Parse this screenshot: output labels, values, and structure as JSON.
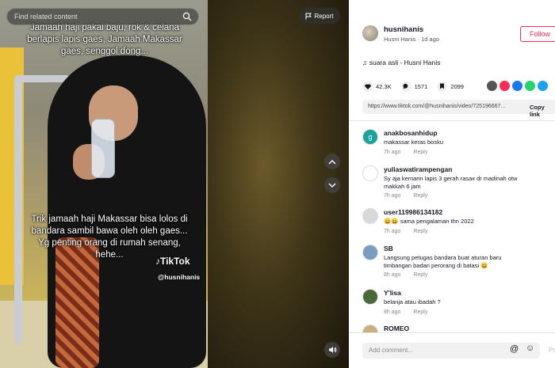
{
  "video": {
    "search_placeholder": "Find related content",
    "report_label": "Report",
    "caption_top": "Jamaah haji pakai baju, rok & celana berlapis lapis gaes, Jamaah Makassar gaes, senggol dong...",
    "caption_bottom": "Trik jamaah haji Makassar bisa lolos di bandara sambil bawa oleh oleh gaes... Yg penting orang di rumah senang, hehe...",
    "watermark": "TikTok",
    "watermark_handle": "@husnihanis"
  },
  "author": {
    "username": "husnihanis",
    "display_line": "Husni Hanis · 1d ago",
    "follow_label": "Follow"
  },
  "sound": "♫ suara asli - Husni Hanis",
  "stats": {
    "likes": "42.3K",
    "comments": "1571",
    "saves": "2099"
  },
  "share_colors": [
    "#555555",
    "#fe2c55",
    "#1877f2",
    "#25d366",
    "#1da1f2"
  ],
  "link": {
    "url": "https://www.tiktok.com/@husnihanis/video/725196667...",
    "copy_label": "Copy link"
  },
  "comments": [
    {
      "user": "anakbosanhidup",
      "text": "makassar keras bosku",
      "text2": "",
      "time": "7h ago",
      "reply": "Reply",
      "avatar_color": "#1aa39a",
      "avatar_letter": "g"
    },
    {
      "user": "yuliaswatirampengan",
      "text": "Sy aja kemarin lapis 3 gerah rasax dr madinah otw",
      "text2": "makkah 6 jam",
      "time": "7h ago",
      "reply": "Reply",
      "avatar_color": "#ffffff",
      "avatar_letter": ""
    },
    {
      "user": "user119986134182",
      "text": "😀😀 sama pengalaman thn 2022",
      "text2": "",
      "time": "7h ago",
      "reply": "Reply",
      "avatar_color": "#d9d9d9",
      "avatar_letter": ""
    },
    {
      "user": "SB",
      "text": "Langsung petugas bandara buat aturan baru",
      "text2": "timbangan badan perorang di batasi 😀",
      "time": "8h ago",
      "reply": "Reply",
      "avatar_color": "#7a9cc0",
      "avatar_letter": ""
    },
    {
      "user": "Y'lisa",
      "text": "belanja atau ibadah ?",
      "text2": "",
      "time": "8h ago",
      "reply": "Reply",
      "avatar_color": "#4a6a3a",
      "avatar_letter": ""
    },
    {
      "user": "ROMEO",
      "text": "",
      "text2": "",
      "time": "",
      "reply": "",
      "avatar_color": "#c9b080",
      "avatar_letter": ""
    }
  ],
  "add_comment_placeholder": "Add comment...",
  "post_label": "Post"
}
